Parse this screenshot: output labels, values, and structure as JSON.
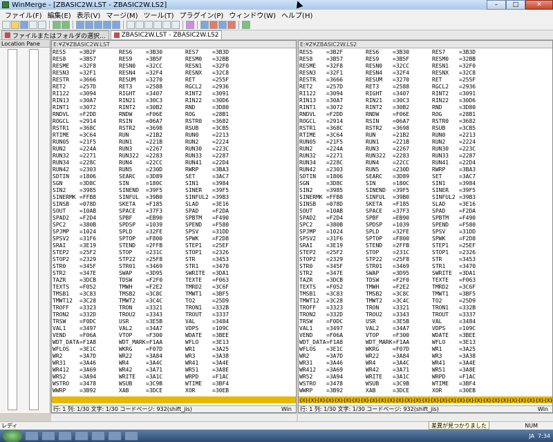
{
  "window": {
    "title": "WinMerge - [ZBASIC2W.LST - ZBASIC2W.LS2]",
    "minimize": "–",
    "maximize": "□",
    "close": "✕"
  },
  "menu": [
    "ファイル(F)",
    "編集(E)",
    "表示(V)",
    "マージ(M)",
    "ツール(T)",
    "プラグイン(P)",
    "ウィンドウ(W)",
    "ヘルプ(H)"
  ],
  "tabs": [
    {
      "label": "ファイルまたはフォルダの選択..."
    },
    {
      "label": "ZBASIC2W.LST - ZBASIC2W.LS2"
    }
  ],
  "location_pane": {
    "title": "Location Pane"
  },
  "left_pane": {
    "path": "E:¥Z¥ZBASIC2W.LST",
    "status": "行: 1  列: 1/30  文字: 1/30  コードページ: 932(shift_jis)",
    "eol": "Win"
  },
  "right_pane": {
    "path": "E:¥Z¥ZBASIC2W.LS2",
    "status": "行: 1  列: 1/30  文字: 1/30  コードページ: 932(shift_jis)",
    "eol": "Win"
  },
  "rows": [
    [
      "RES5",
      "=3B2F",
      "RES6",
      "=3B30",
      "RES7",
      "=3B3D"
    ],
    [
      "RES8",
      "=3B57",
      "RES9",
      "=3B5F",
      "RESM0",
      "=32BB"
    ],
    [
      "RESME",
      "=32F8",
      "RESN0",
      "=32CC",
      "RESN1",
      "=32F0"
    ],
    [
      "RESN3",
      "=32F1",
      "RESN4",
      "=32F4",
      "RESNX",
      "=32C8"
    ],
    [
      "RESTR",
      "=3666",
      "RESUM",
      "=3270",
      "RET",
      "=255F"
    ],
    [
      "RET2",
      "=257D",
      "RET3",
      "=2588",
      "RGCL2",
      "=2936"
    ],
    [
      "RI122",
      "=3094",
      "RIGHT",
      "=3407",
      "RINT2",
      "=3091"
    ],
    [
      "RIN13",
      "=30A7",
      "RIN21",
      "=30C3",
      "RIN22",
      "=30D6"
    ],
    [
      "RINT1",
      "=3072",
      "RINT2",
      "=30B2",
      "RND",
      "=3D80"
    ],
    [
      "RNDVL",
      "=F2DD",
      "RNDW",
      "=F06E",
      "ROG",
      "=28B1"
    ],
    [
      "ROGCL",
      "=2914",
      "RSIN",
      "=06A7",
      "RSTR0",
      "=3682"
    ],
    [
      "RSTR1",
      "=368C",
      "RSTR2",
      "=3698",
      "RSUB",
      "=3CB5"
    ],
    [
      "RTIME",
      "=3C64",
      "RUN",
      "=21B2",
      "RUN0",
      "=2213"
    ],
    [
      "RUN05",
      "=21F5",
      "RUN1",
      "=221B",
      "RUN2",
      "=2224"
    ],
    [
      "RUN2",
      "=224A",
      "RUN3",
      "=2267",
      "RUN30",
      "=223C"
    ],
    [
      "RUN32",
      "=2271",
      "RUN322",
      "=2283",
      "RUN33",
      "=2287"
    ],
    [
      "RUN34",
      "=228C",
      "RUN4",
      "=22CC",
      "RUN41",
      "=22D4"
    ],
    [
      "RUN42",
      "=2303",
      "RUN5",
      "=230D",
      "RWRP",
      "=3BA3"
    ],
    [
      "SDTIN",
      "=1806",
      "SEARC",
      "=3D89",
      "SET",
      "=3AC7"
    ],
    [
      "SGN",
      "=3D8C",
      "SIN",
      "=180C",
      "SIN1",
      "=3984"
    ],
    [
      "SIN2",
      "=3985",
      "SINEND",
      "=39F5",
      "SINER",
      "=39F5"
    ],
    [
      "SINERMK",
      "=FFB8",
      "SINFUL",
      "=39B0",
      "SINFUL2",
      "=39B3"
    ],
    [
      "SINSB",
      "=078D",
      "SKETA",
      "=F185",
      "SLAD",
      "=3E16"
    ],
    [
      "SOUT",
      "=10AB",
      "SPACE",
      "=37F3",
      "SPAD",
      "=F2DA"
    ],
    [
      "SPAD2",
      "=F2D4",
      "SPBF",
      "=EB90",
      "SPBTM",
      "=F490"
    ],
    [
      "SPC2",
      "=380B",
      "SPDSP",
      "=1039",
      "SPEND",
      "=F580"
    ],
    [
      "SPJMP",
      "=1024",
      "SPLD",
      "=32FE",
      "SPSV",
      "=31DD"
    ],
    [
      "SPSV2",
      "=31F6",
      "SPTOP",
      "=F800",
      "SPWK",
      "=F2D8"
    ],
    [
      "SRAI",
      "=3E19",
      "STEND",
      "=2FFB",
      "STEP1",
      "=25EF"
    ],
    [
      "STEP2",
      "=25F2",
      "STOP",
      "=231C",
      "STOP1",
      "=2326"
    ],
    [
      "STOP2",
      "=2329",
      "STP22",
      "=25F8",
      "STR",
      "=3453"
    ],
    [
      "STR0",
      "=345F",
      "STR01",
      "=3469",
      "STR1",
      "=3470"
    ],
    [
      "STR2",
      "=347E",
      "SWAP",
      "=3D95",
      "SWRITE",
      "=3DA1"
    ],
    [
      "TAZR",
      "=3DCB",
      "TDSW",
      "=F2F0",
      "TEXTE",
      "=F063"
    ],
    [
      "TEXTS",
      "=F052",
      "TMWH",
      "=F2E2",
      "TMRD2",
      "=3C6F"
    ],
    [
      "TMSB1",
      "=3C83",
      "TMSB2",
      "=3C8C",
      "TMWT1",
      "=3BF5"
    ],
    [
      "TMWT12",
      "=3C28",
      "TMWT2",
      "=3C4C",
      "TO2",
      "=25D9"
    ],
    [
      "TROFF",
      "=3323",
      "TRON",
      "=3321",
      "TRON1",
      "=332B"
    ],
    [
      "TRON2",
      "=332D",
      "TROU2",
      "=3343",
      "TROUT",
      "=3337"
    ],
    [
      "TRSW",
      "=F0DC",
      "USR",
      "=3E5B",
      "VAL",
      "=3484"
    ],
    [
      "VAL1",
      "=3497",
      "VAL2",
      "=34A7",
      "VDPS",
      "=109C"
    ],
    [
      "VEND",
      "=F06A",
      "VTOP",
      "=F300",
      "WDATE",
      "=3BEE"
    ],
    [
      "WDT_DATA",
      "=F1A8",
      "WDT_MARK",
      "=F1AA",
      "WFLO",
      "=3E13"
    ],
    [
      "WFLOS",
      "=3E1C",
      "WKRG",
      "=F07D",
      "WR1",
      "=3A25"
    ],
    [
      "WR2",
      "=3A7D",
      "WR22",
      "=3A84",
      "WR3",
      "=3A38"
    ],
    [
      "WR31",
      "=3A46",
      "WR4",
      "=3A4C",
      "WR41",
      "=3A4E"
    ],
    [
      "WR412",
      "=3A69",
      "WR42",
      "=3A71",
      "WR51",
      "=3A8E"
    ],
    [
      "WR52",
      "=3A94",
      "WRITE",
      "=3A1C",
      "WRPD",
      "=F1AC"
    ],
    [
      "WSTRO",
      "=3478",
      "WSUB",
      "=3C9B",
      "WTIME",
      "=3BF4"
    ],
    [
      "WWRP",
      "=3B92",
      "XAB",
      "=3DCE",
      "XOR",
      "=30EB"
    ]
  ],
  "highlight_right": "{X}{X}{X}{X}{X}{X}{X}{X}{X}{X}{X}{X}{X}{X}{X}{X}{X}{X}{X}{X}{X}{X}{X}{X}{X}{X}{X}{X}{X}{X}",
  "statusbar": {
    "ready": "レディ",
    "num": "NUM",
    "balloon": "差異が見つかりました"
  },
  "taskbar": {
    "time": "7:34",
    "lang": "JA"
  },
  "colors": {
    "diff_highlight": "#e8b800",
    "titlebar": "#a9c9eb",
    "taskbar": "#2e4a6e"
  }
}
